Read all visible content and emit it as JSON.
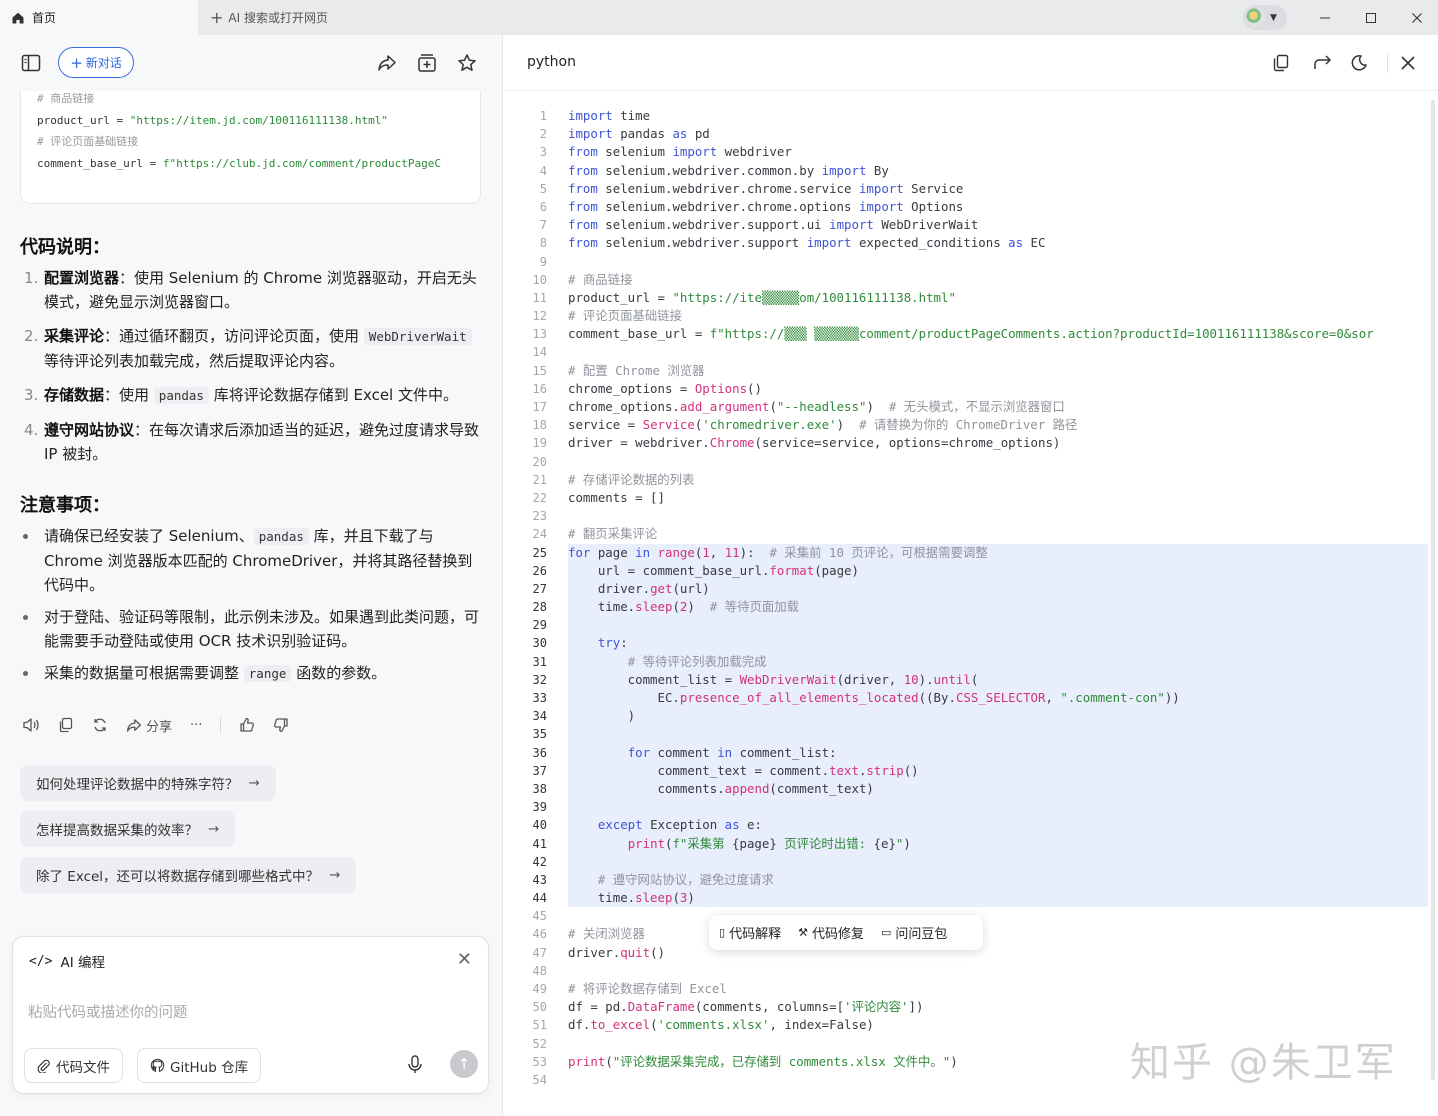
{
  "titlebar": {
    "tab_home_label": "首页",
    "tab_new_label": "AI 搜索或打开网页"
  },
  "left": {
    "new_chat_label": "新对话",
    "code_snippet": [
      {
        "type": "comment",
        "text": "# 商品链接"
      },
      {
        "type": "code",
        "prefix": "product_url = ",
        "string": "\"https://item.jd.com/100116111138.html\""
      },
      {
        "type": "comment",
        "text": "# 评论页面基础链接"
      },
      {
        "type": "code",
        "prefix": "comment_base_url = ",
        "string": "f\"https://club.jd.com/comment/productPageC"
      }
    ],
    "section1_title": "代码说明：",
    "explain_items": [
      {
        "num": "1.",
        "bold": "配置浏览器",
        "rest": "：使用 Selenium 的 Chrome 浏览器驱动，开启无头模式，避免显示浏览器窗口。"
      },
      {
        "num": "2.",
        "bold": "采集评论",
        "rest_before": "：通过循环翻页，访问评论页面，使用 ",
        "code": "WebDriverWait",
        "rest_after": " 等待评论列表加载完成，然后提取评论内容。"
      },
      {
        "num": "3.",
        "bold": "存储数据",
        "rest_before": "：使用 ",
        "code": "pandas",
        "rest_after": " 库将评论数据存储到 Excel 文件中。"
      },
      {
        "num": "4.",
        "bold": "遵守网站协议",
        "rest": "：在每次请求后添加适当的延迟，避免过度请求导致 IP 被封。"
      }
    ],
    "section2_title": "注意事项：",
    "note_items": [
      {
        "before": "请确保已经安装了 Selenium、",
        "code": "pandas",
        "after": " 库，并且下载了与 Chrome 浏览器版本匹配的 ChromeDriver，并将其路径替换到代码中。"
      },
      {
        "before": "对于登陆、验证码等限制，此示例未涉及。如果遇到此类问题，可能需要手动登陆或使用 OCR 技术识别验证码。",
        "code": "",
        "after": ""
      },
      {
        "before": "采集的数据量可根据需要调整 ",
        "code": "range",
        "after": " 函数的参数。"
      }
    ],
    "share_label": "分享",
    "suggestions": [
      "如何处理评论数据中的特殊字符？",
      "怎样提高数据采集的效率？",
      "除了 Excel，还可以将数据存储到哪些格式中？"
    ],
    "input": {
      "header_label": "AI 编程",
      "placeholder": "粘贴代码或描述你的问题",
      "code_file_label": "代码文件",
      "github_label": "GitHub 仓库"
    }
  },
  "right": {
    "language": "python",
    "popup": {
      "explain_label": "代码解释",
      "fix_label": "代码修复",
      "ask_label": "问问豆包"
    },
    "watermark": "知乎 @朱卫军",
    "code_lines": [
      [
        [
          "kw",
          "import"
        ],
        [
          "t",
          " time"
        ]
      ],
      [
        [
          "kw",
          "import"
        ],
        [
          "t",
          " pandas "
        ],
        [
          "kw",
          "as"
        ],
        [
          "t",
          " pd"
        ]
      ],
      [
        [
          "kw",
          "from"
        ],
        [
          "t",
          " selenium "
        ],
        [
          "kw",
          "import"
        ],
        [
          "t",
          " webdriver"
        ]
      ],
      [
        [
          "kw",
          "from"
        ],
        [
          "t",
          " selenium.webdriver.common.by "
        ],
        [
          "kw",
          "import"
        ],
        [
          "t",
          " By"
        ]
      ],
      [
        [
          "kw",
          "from"
        ],
        [
          "t",
          " selenium.webdriver.chrome.service "
        ],
        [
          "kw",
          "import"
        ],
        [
          "t",
          " Service"
        ]
      ],
      [
        [
          "kw",
          "from"
        ],
        [
          "t",
          " selenium.webdriver.chrome.options "
        ],
        [
          "kw",
          "import"
        ],
        [
          "t",
          " Options"
        ]
      ],
      [
        [
          "kw",
          "from"
        ],
        [
          "t",
          " selenium.webdriver.support.ui "
        ],
        [
          "kw",
          "import"
        ],
        [
          "t",
          " WebDriverWait"
        ]
      ],
      [
        [
          "kw",
          "from"
        ],
        [
          "t",
          " selenium.webdriver.support "
        ],
        [
          "kw",
          "import"
        ],
        [
          "t",
          " expected_conditions "
        ],
        [
          "kw",
          "as"
        ],
        [
          "t",
          " EC"
        ]
      ],
      [],
      [
        [
          "c",
          "# 商品链接"
        ]
      ],
      [
        [
          "t",
          "product_url = "
        ],
        [
          "s",
          "\"https://ite▒▒▒▒▒om/100116111138.html\""
        ]
      ],
      [
        [
          "c",
          "# 评论页面基础链接"
        ]
      ],
      [
        [
          "t",
          "comment_base_url = "
        ],
        [
          "s",
          "f\"https://▒▒▒ ▒▒▒▒▒▒comment/productPageComments.action?productId=100116111138&score=0&sor"
        ]
      ],
      [],
      [
        [
          "c",
          "# 配置 Chrome 浏览器"
        ]
      ],
      [
        [
          "t",
          "chrome_options = "
        ],
        [
          "fn",
          "Options"
        ],
        [
          "t",
          "()"
        ]
      ],
      [
        [
          "t",
          "chrome_options."
        ],
        [
          "fn",
          "add_argument"
        ],
        [
          "t",
          "("
        ],
        [
          "s",
          "\"--headless\""
        ],
        [
          "t",
          ")  "
        ],
        [
          "c",
          "# 无头模式，不显示浏览器窗口"
        ]
      ],
      [
        [
          "t",
          "service = "
        ],
        [
          "fn",
          "Service"
        ],
        [
          "t",
          "("
        ],
        [
          "s",
          "'chromedriver.exe'"
        ],
        [
          "t",
          ")  "
        ],
        [
          "c",
          "# 请替换为你的 ChromeDriver 路径"
        ]
      ],
      [
        [
          "t",
          "driver = webdriver."
        ],
        [
          "fn",
          "Chrome"
        ],
        [
          "t",
          "(service=service, options=chrome_options)"
        ]
      ],
      [],
      [
        [
          "c",
          "# 存储评论数据的列表"
        ]
      ],
      [
        [
          "t",
          "comments = []"
        ]
      ],
      [],
      [
        [
          "c",
          "# 翻页采集评论"
        ]
      ],
      [
        [
          "kw",
          "for"
        ],
        [
          "t",
          " page "
        ],
        [
          "kw",
          "in"
        ],
        [
          "t",
          " "
        ],
        [
          "fn",
          "range"
        ],
        [
          "t",
          "("
        ],
        [
          "n",
          "1"
        ],
        [
          "t",
          ", "
        ],
        [
          "n",
          "11"
        ],
        [
          "t",
          "):  "
        ],
        [
          "c",
          "# 采集前 10 页评论，可根据需要调整"
        ]
      ],
      [
        [
          "t",
          "    url = comment_base_url."
        ],
        [
          "fn",
          "format"
        ],
        [
          "t",
          "(page)"
        ]
      ],
      [
        [
          "t",
          "    driver."
        ],
        [
          "fn",
          "get"
        ],
        [
          "t",
          "(url)"
        ]
      ],
      [
        [
          "t",
          "    time."
        ],
        [
          "fn",
          "sleep"
        ],
        [
          "t",
          "("
        ],
        [
          "n",
          "2"
        ],
        [
          "t",
          ")  "
        ],
        [
          "c",
          "# 等待页面加载"
        ]
      ],
      [],
      [
        [
          "t",
          "    "
        ],
        [
          "kw",
          "try"
        ],
        [
          "t",
          ":"
        ]
      ],
      [
        [
          "t",
          "        "
        ],
        [
          "c",
          "# 等待评论列表加载完成"
        ]
      ],
      [
        [
          "t",
          "        comment_list = "
        ],
        [
          "fn",
          "WebDriverWait"
        ],
        [
          "t",
          "(driver, "
        ],
        [
          "n",
          "10"
        ],
        [
          "t",
          ")."
        ],
        [
          "fn",
          "until"
        ],
        [
          "t",
          "("
        ]
      ],
      [
        [
          "t",
          "            EC."
        ],
        [
          "fn",
          "presence_of_all_elements_located"
        ],
        [
          "t",
          "((By."
        ],
        [
          "fn",
          "CSS_SELECTOR"
        ],
        [
          "t",
          ", "
        ],
        [
          "s",
          "\".comment-con\""
        ],
        [
          "t",
          "))"
        ]
      ],
      [
        [
          "t",
          "        )"
        ]
      ],
      [],
      [
        [
          "t",
          "        "
        ],
        [
          "kw",
          "for"
        ],
        [
          "t",
          " comment "
        ],
        [
          "kw",
          "in"
        ],
        [
          "t",
          " comment_list:"
        ]
      ],
      [
        [
          "t",
          "            comment_text = comment."
        ],
        [
          "fn",
          "text"
        ],
        [
          "t",
          "."
        ],
        [
          "fn",
          "strip"
        ],
        [
          "t",
          "()"
        ]
      ],
      [
        [
          "t",
          "            comments."
        ],
        [
          "fn",
          "append"
        ],
        [
          "t",
          "(comment_text)"
        ]
      ],
      [],
      [
        [
          "t",
          "    "
        ],
        [
          "kw",
          "except"
        ],
        [
          "t",
          " Exception "
        ],
        [
          "kw",
          "as"
        ],
        [
          "t",
          " e:"
        ]
      ],
      [
        [
          "t",
          "        "
        ],
        [
          "fn",
          "print"
        ],
        [
          "t",
          "("
        ],
        [
          "s",
          "f\"采集第 "
        ],
        [
          "t",
          "{page}"
        ],
        [
          "s",
          " 页评论时出错: "
        ],
        [
          "t",
          "{e}"
        ],
        [
          "s",
          "\""
        ],
        [
          "t",
          ")"
        ]
      ],
      [],
      [
        [
          "t",
          "    "
        ],
        [
          "c",
          "# 遵守网站协议，避免过度请求"
        ]
      ],
      [
        [
          "t",
          "    time."
        ],
        [
          "fn",
          "sleep"
        ],
        [
          "t",
          "("
        ],
        [
          "n",
          "3"
        ],
        [
          "t",
          ")"
        ]
      ],
      [],
      [
        [
          "c",
          "# 关闭浏览器"
        ]
      ],
      [
        [
          "t",
          "driver."
        ],
        [
          "fn",
          "quit"
        ],
        [
          "t",
          "()"
        ]
      ],
      [],
      [
        [
          "c",
          "# 将评论数据存储到 Excel"
        ]
      ],
      [
        [
          "t",
          "df = pd."
        ],
        [
          "fn",
          "DataFrame"
        ],
        [
          "t",
          "(comments, columns=["
        ],
        [
          "s",
          "'评论内容'"
        ],
        [
          "t",
          "])"
        ]
      ],
      [
        [
          "t",
          "df."
        ],
        [
          "fn",
          "to_excel"
        ],
        [
          "t",
          "("
        ],
        [
          "s",
          "'comments.xlsx'"
        ],
        [
          "t",
          ", index=False)"
        ]
      ],
      [],
      [
        [
          "fn",
          "print"
        ],
        [
          "t",
          "("
        ],
        [
          "s",
          "\"评论数据采集完成，已存储到 comments.xlsx 文件中。\""
        ],
        [
          "t",
          ")"
        ]
      ],
      []
    ]
  }
}
